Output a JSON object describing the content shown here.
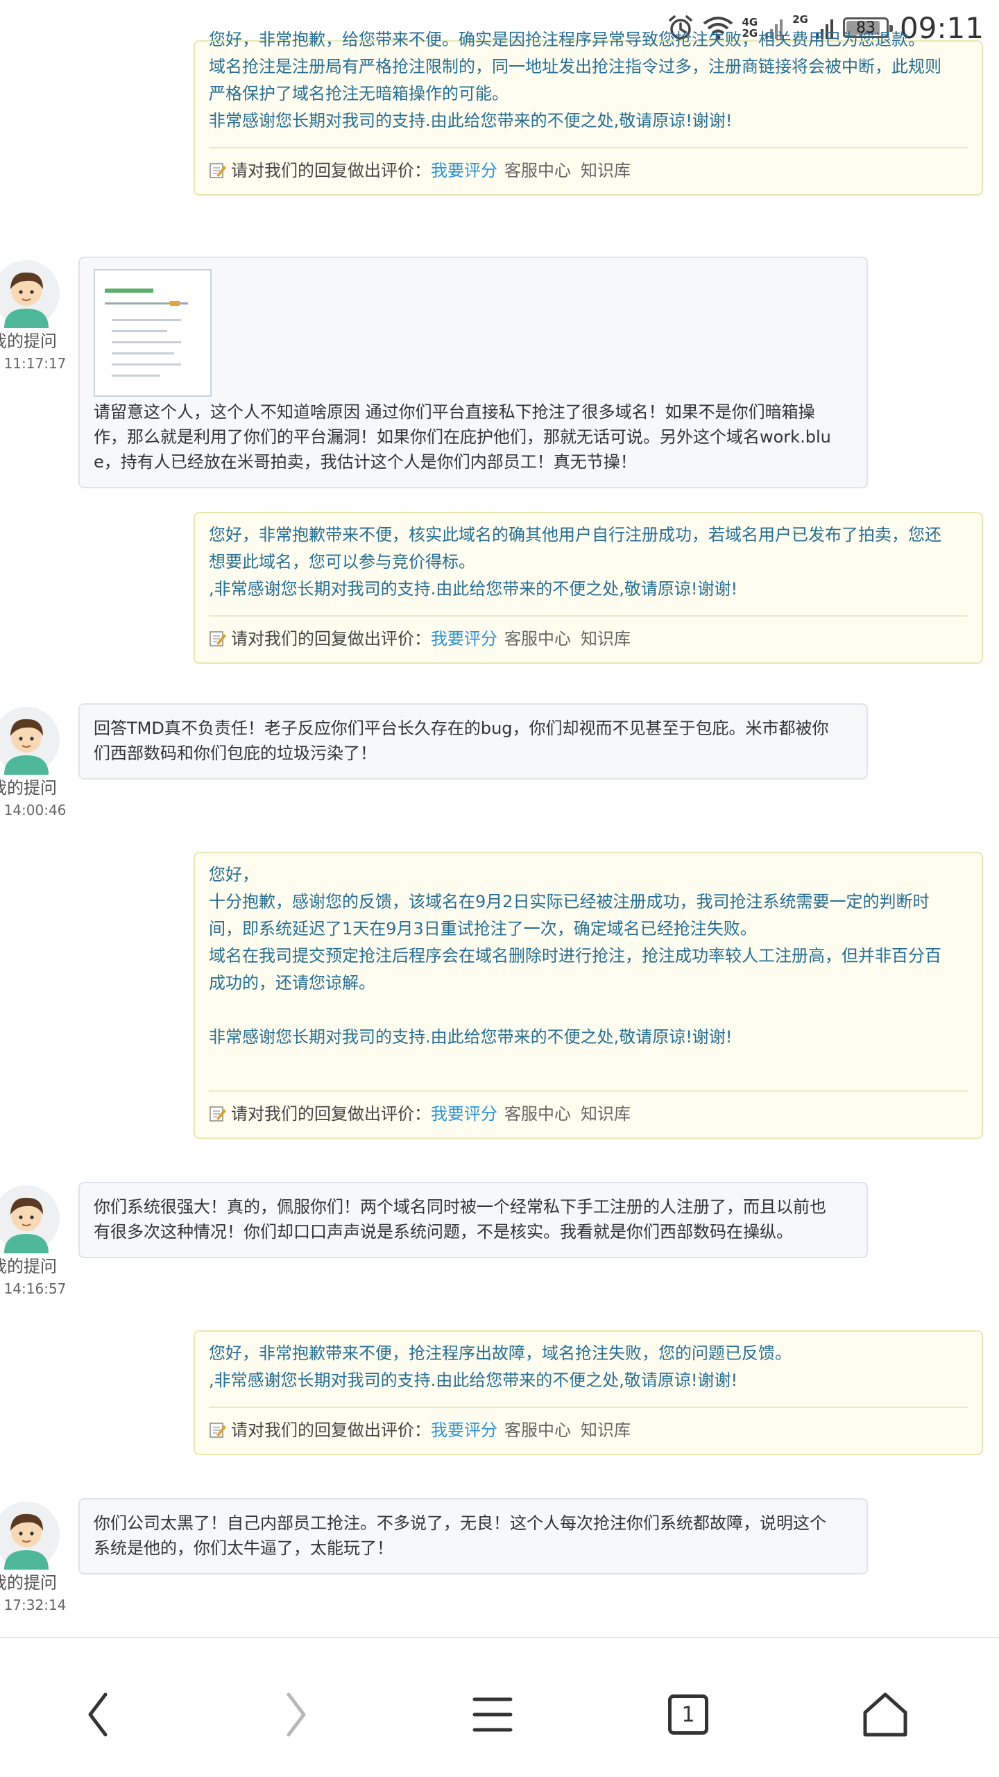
{
  "status_bar": {
    "net1_top": "4G",
    "net1_bottom": "2G",
    "net2": "2G",
    "battery": "83",
    "time": "09:11"
  },
  "rating": {
    "prompt": "请对我们的回复做出评价：",
    "rate_link": "我要评分",
    "service_center": "客服中心",
    "knowledge_base": "知识库"
  },
  "replies": [
    {
      "lines": [
        "您好，非常抱歉，给您带来不便。确实是因抢注程序异常导致您抢注失败，相关费用已为您退款。",
        "域名抢注是注册局有严格抢注限制的，同一地址发出抢注指令过多，注册商链接将会被中断，此规则",
        "严格保护了域名抢注无暗箱操作的可能。",
        "非常感谢您长期对我司的支持.由此给您带来的不便之处,敬请原谅!谢谢!"
      ]
    },
    {
      "lines": [
        "您好，非常抱歉带来不便，核实此域名的确其他用户自行注册成功，若域名用户已发布了拍卖，您还",
        "想要此域名，您可以参与竞价得标。",
        ",非常感谢您长期对我司的支持.由此给您带来的不便之处,敬请原谅!谢谢!"
      ]
    },
    {
      "lines": [
        "您好，",
        "十分抱歉，感谢您的反馈，该域名在9月2日实际已经被注册成功，我司抢注系统需要一定的判断时",
        "间，即系统延迟了1天在9月3日重试抢注了一次，确定域名已经抢注失败。",
        "域名在我司提交预定抢注后程序会在域名删除时进行抢注，抢注成功率较人工注册高，但并非百分百",
        "成功的，还请您谅解。",
        "",
        "非常感谢您长期对我司的支持.由此给您带来的不便之处,敬请原谅!谢谢!",
        ""
      ]
    },
    {
      "lines": [
        "您好，非常抱歉带来不便，抢注程序出故障，域名抢注失败，您的问题已反馈。",
        ",非常感谢您长期对我司的支持.由此给您带来的不便之处,敬请原谅!谢谢!"
      ]
    }
  ],
  "questions": [
    {
      "user_label": "我的提问",
      "time": "- 11:17:17",
      "lines": [
        "请留意这个人，这个人不知道啥原因 通过你们平台直接私下抢注了很多域名！如果不是你们暗箱操",
        "作，那么就是利用了你们的平台漏洞！如果你们在庇护他们，那就无话可说。另外这个域名work.blu",
        "e，持有人已经放在米哥拍卖，我估计这个人是你们内部员工！真无节操！"
      ]
    },
    {
      "user_label": "我的提问",
      "time": "- 14:00:46",
      "lines": [
        "回答TMD真不负责任！老子反应你们平台长久存在的bug，你们却视而不见甚至于包庇。米市都被你",
        "们西部数码和你们包庇的垃圾污染了！"
      ]
    },
    {
      "user_label": "我的提问",
      "time": "- 14:16:57",
      "lines": [
        "你们系统很强大！真的，佩服你们！两个域名同时被一个经常私下手工注册的人注册了，而且以前也",
        "有很多次这种情况！你们却口口声声说是系统问题，不是核实。我看就是你们西部数码在操纵。"
      ]
    },
    {
      "user_label": "我的提问",
      "time": "- 17:32:14",
      "lines": [
        "你们公司太黑了！自己内部员工抢注。不多说了，无良！这个人每次抢注你们系统都故障，说明这个",
        "系统是他的，你们太牛逼了，太能玩了！"
      ]
    }
  ],
  "nav": {
    "tab_count": "1"
  }
}
